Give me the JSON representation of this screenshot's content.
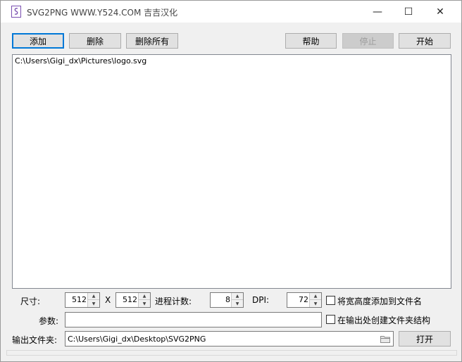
{
  "window": {
    "title": "SVG2PNG WWW.Y524.COM 吉吉汉化",
    "minimize": "—",
    "maximize": "☐",
    "close": "✕"
  },
  "toolbar": {
    "add": "添加",
    "delete": "删除",
    "delete_all": "删除所有",
    "help": "帮助",
    "stop": "停止",
    "start": "开始"
  },
  "files": [
    "C:\\Users\\Gigi_dx\\Pictures\\logo.svg"
  ],
  "options": {
    "size_label": "尺寸:",
    "width": "512",
    "x_label": "X",
    "height": "512",
    "threads_label": "进程计数:",
    "threads": "8",
    "dpi_label": "DPI:",
    "dpi": "72",
    "append_size_label": "将宽高度添加到文件名",
    "params_label": "参数:",
    "params_value": "",
    "create_structure_label": "在输出处创建文件夹结构",
    "output_label": "输出文件夹:",
    "output_path": "C:\\Users\\Gigi_dx\\Desktop\\SVG2PNG",
    "open": "打开"
  }
}
